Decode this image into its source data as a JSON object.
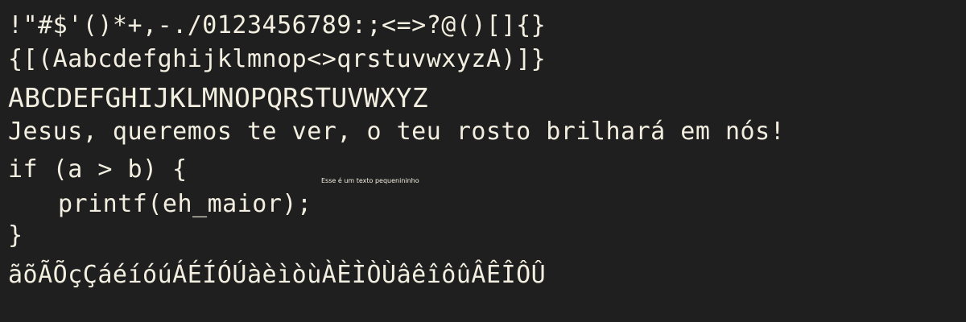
{
  "lines": {
    "punctuation": "!\"#$'()*+,-./0123456789:;<=>?@()[]{}",
    "lowercase": "{[(Aabcdefghijklmnop<>qrstuvwxyzA)]}",
    "uppercase": "ABCDEFGHIJKLMNOPQRSTUVWXYZ",
    "sentence": "Jesus, queremos te ver, o teu rosto brilhará em nós!",
    "code_open": "if (a > b) {",
    "code_body": "printf(eh_maior);",
    "code_close": "}",
    "accents": "ãõÃÕçÇáéíóúÁÉÍÓÚàèìòùÀÈÌÒÙâêîôûÂÊÎÔÛ"
  },
  "small_text": "Esse é um texto pequenininho",
  "colors": {
    "background": "#1f1f1f",
    "text": "#f2eee0"
  }
}
